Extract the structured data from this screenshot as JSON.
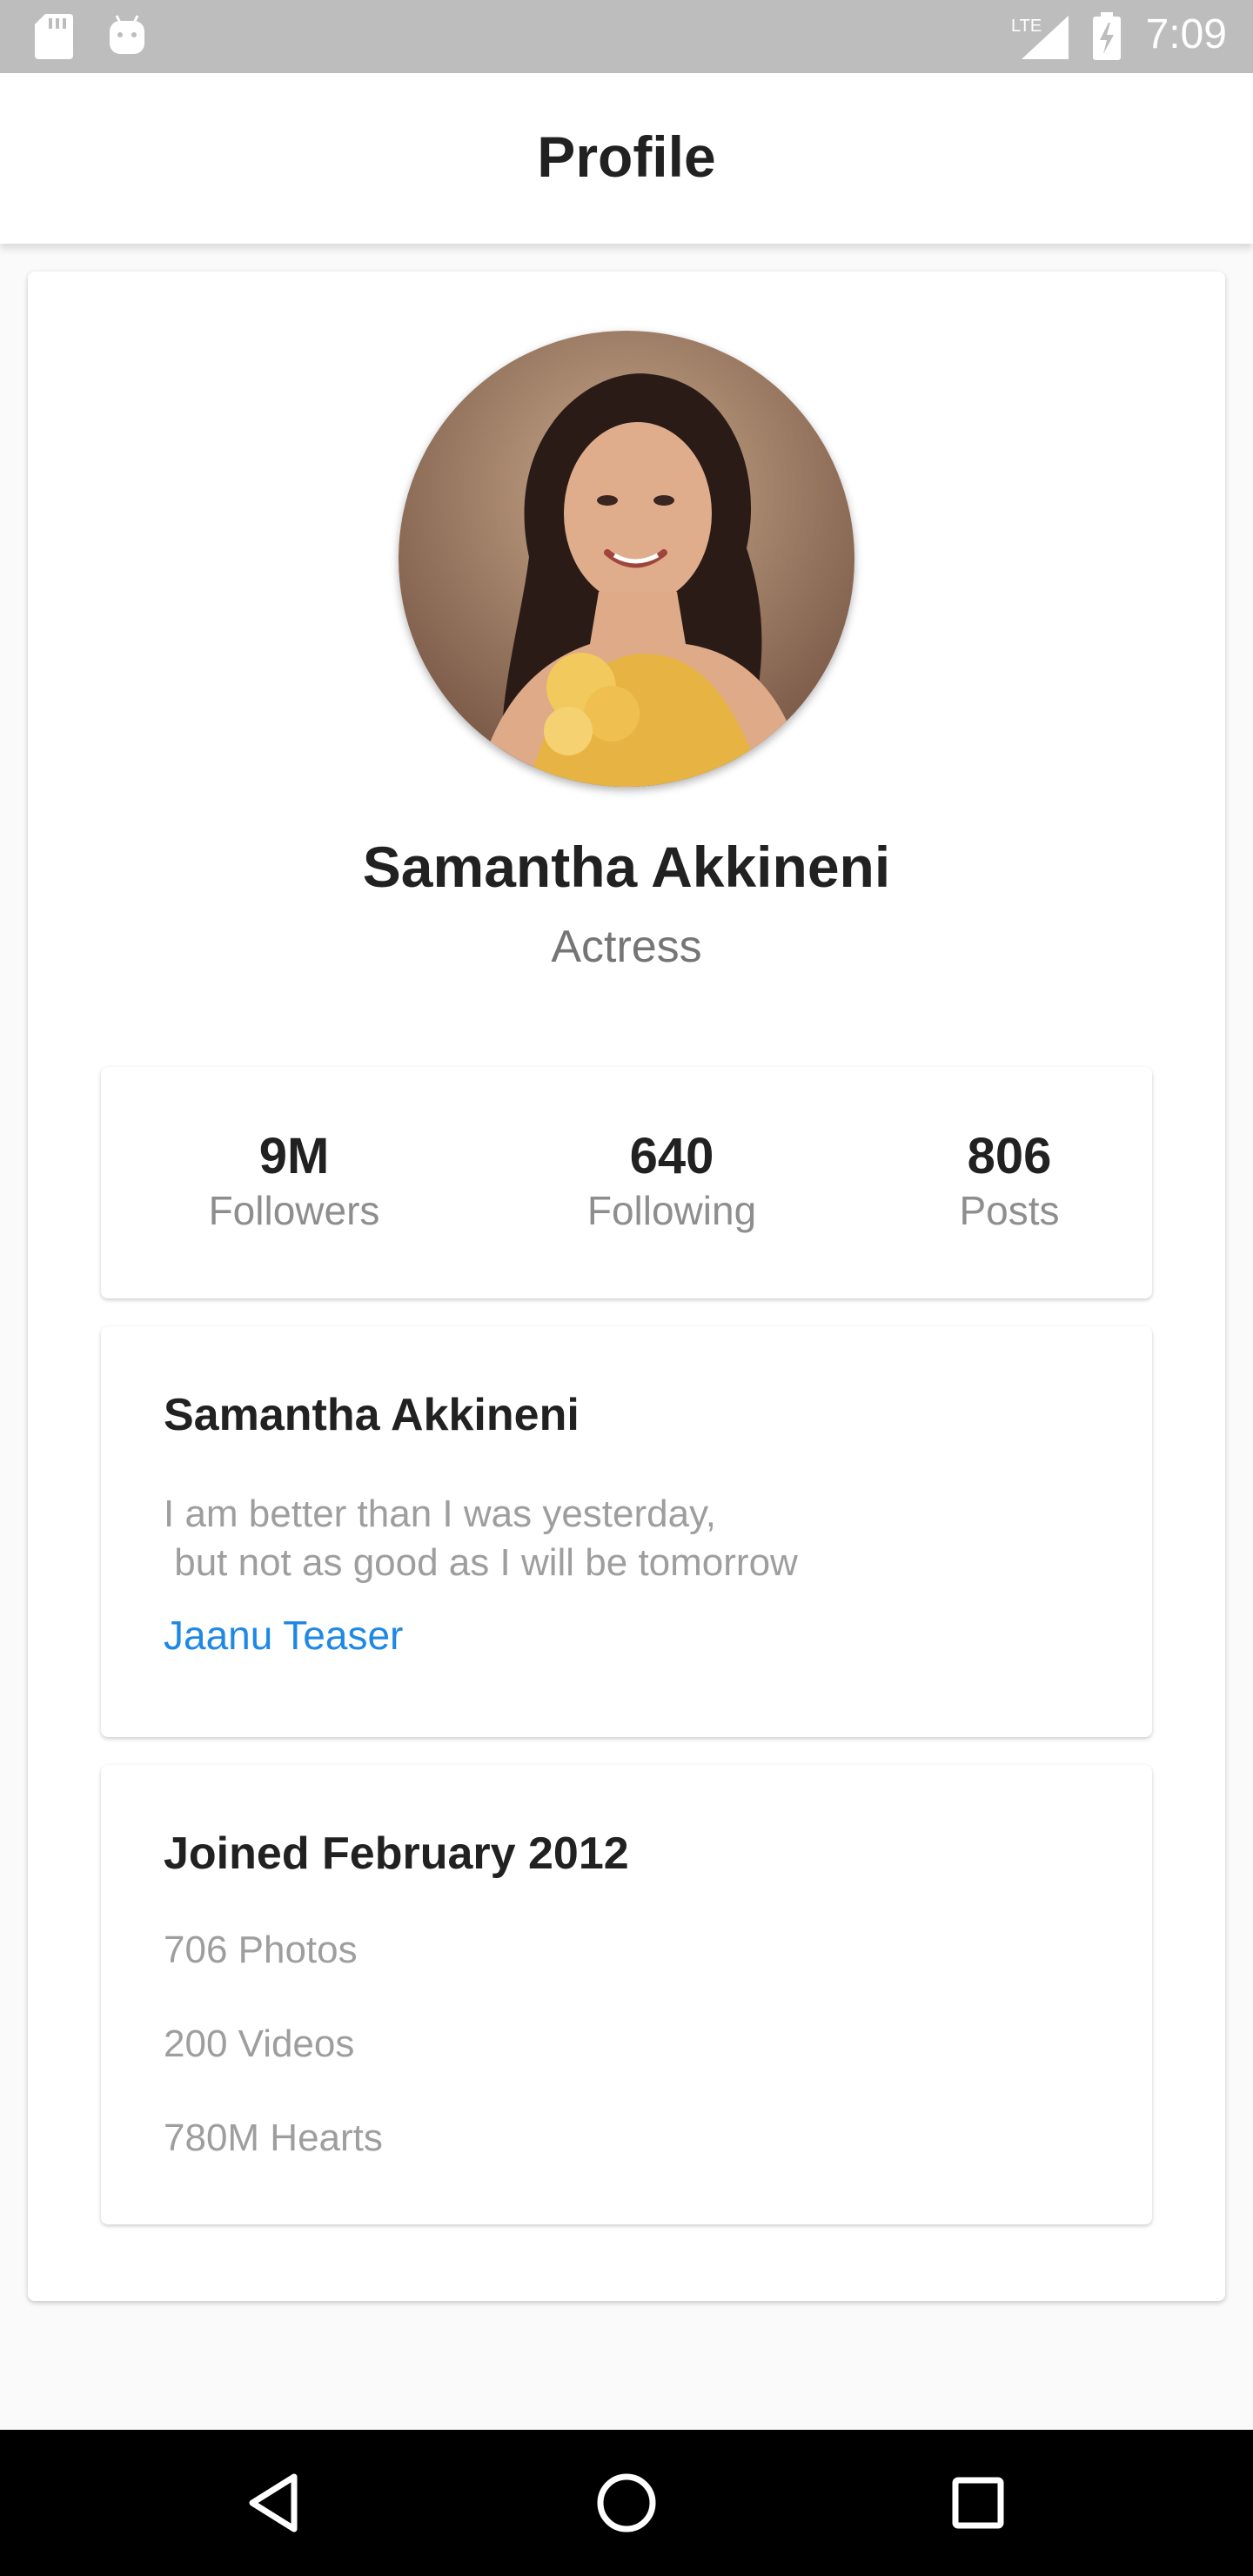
{
  "status_bar": {
    "time": "7:09",
    "network_label": "LTE"
  },
  "app_bar": {
    "title": "Profile"
  },
  "profile": {
    "name": "Samantha Akkineni",
    "role": "Actress"
  },
  "stats": [
    {
      "value": "9M",
      "label": "Followers"
    },
    {
      "value": "640",
      "label": "Following"
    },
    {
      "value": "806",
      "label": "Posts"
    }
  ],
  "bio": {
    "heading": "Samantha Akkineni",
    "text": "I am better than I was yesterday,\n but not as good as I will be tomorrow",
    "link": "Jaanu Teaser"
  },
  "joined": {
    "heading": "Joined February 2012",
    "items": [
      "706 Photos",
      "200 Videos",
      "780M Hearts"
    ]
  },
  "colors": {
    "link": "#1e88e5",
    "status_bar": "#bdbdbd",
    "nav_bar": "#000000"
  },
  "icons": {
    "status_left": [
      "sd-card-icon",
      "android-icon"
    ],
    "status_right": [
      "lte-signal-icon",
      "battery-charging-icon"
    ],
    "nav": [
      "back-icon",
      "home-icon",
      "recents-icon"
    ]
  }
}
